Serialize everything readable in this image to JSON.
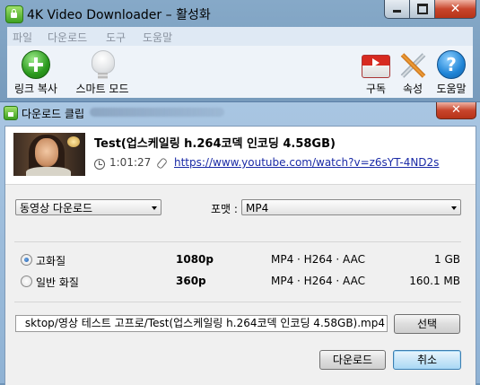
{
  "main_window": {
    "title": "4K Video Downloader – 활성화",
    "menu": [
      "파일",
      "다운로드",
      "도구",
      "도움말"
    ],
    "toolbar": {
      "paste_link": {
        "label": "링크 복사",
        "icon": "add-link-icon"
      },
      "smart_mode": {
        "label": "스마트 모드",
        "icon": "lightbulb-icon"
      },
      "subscriptions": {
        "label": "구독",
        "icon": "youtube-icon"
      },
      "preferences": {
        "label": "속성",
        "icon": "tools-icon"
      },
      "help": {
        "label": "도움말",
        "icon": "help-icon",
        "glyph": "?"
      }
    }
  },
  "dialog": {
    "title": "다운로드 클립",
    "close_glyph": "✕",
    "video": {
      "title": "Test(업스케일링 h.264코덱 인코딩 4.58GB)",
      "duration": "1:01:27",
      "url": "https://www.youtube.com/watch?v=z6sYT-4ND2s"
    },
    "mode": {
      "selected": "동영상 다운로드"
    },
    "format": {
      "label": "포맷 :",
      "selected": "MP4"
    },
    "qualities": [
      {
        "label": "고화질",
        "resolution": "1080p",
        "codec": "MP4 · H264 · AAC",
        "size": "1 GB",
        "selected": true
      },
      {
        "label": "일반 화질",
        "resolution": "360p",
        "codec": "MP4 · H264 · AAC",
        "size": "160.1 MB",
        "selected": false
      }
    ],
    "save_path": "sktop/영상 테스트 고프로/Test(업스케일링 h.264코덱 인코딩 4.58GB).mp4",
    "buttons": {
      "browse": "선택",
      "download": "다운로드",
      "cancel": "취소"
    }
  },
  "colors": {
    "accent": "#2b9a1e",
    "link": "#1a2aa6",
    "close": "#c8452c"
  }
}
